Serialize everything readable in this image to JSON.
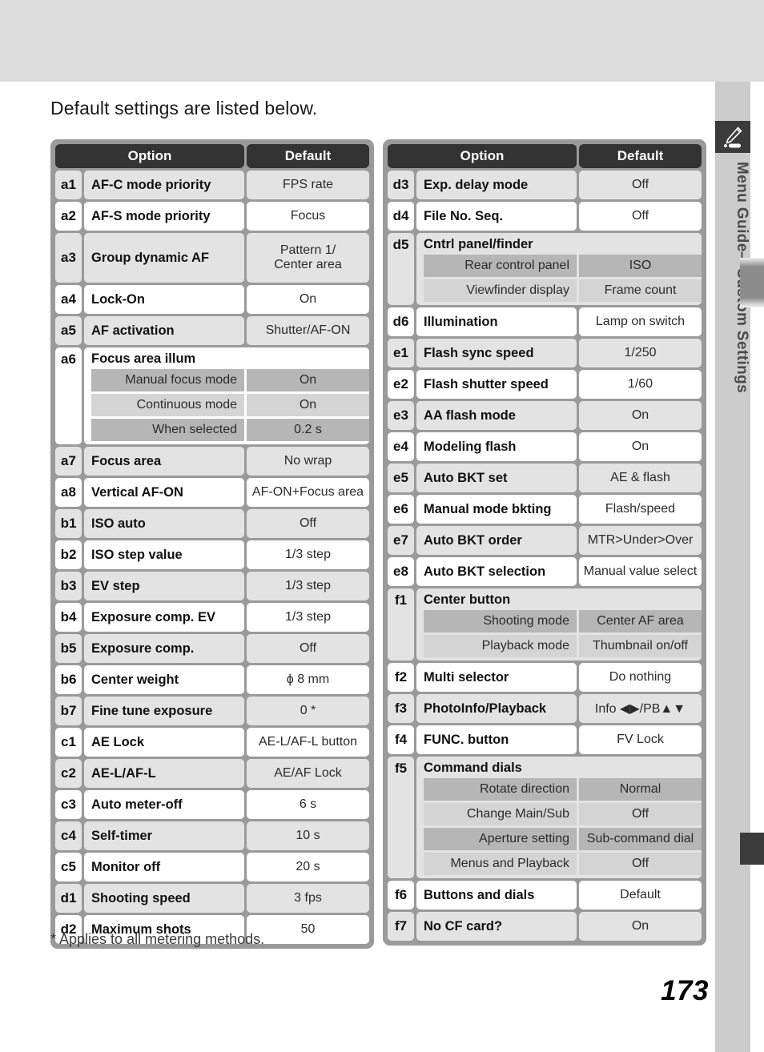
{
  "page": {
    "title": "Default settings are listed below.",
    "footnote": "* Applies to all metering methods.",
    "number": "173",
    "side_label": "Menu Guide—Custom Settings",
    "side_icon": "pencil-icon"
  },
  "table_headers": {
    "option": "Option",
    "default": "Default"
  },
  "left_table": [
    {
      "code": "a1",
      "option": "AF-C mode priority",
      "default": "FPS rate",
      "shade": "gray"
    },
    {
      "code": "a2",
      "option": "AF-S mode priority",
      "default": "Focus",
      "shade": "white"
    },
    {
      "code": "a3",
      "option": "Group dynamic AF",
      "default": "Pattern 1/\nCenter area",
      "shade": "gray",
      "tall": true
    },
    {
      "code": "a4",
      "option": "Lock-On",
      "default": "On",
      "shade": "white"
    },
    {
      "code": "a5",
      "option": "AF activation",
      "default": "Shutter/AF-ON",
      "shade": "gray"
    },
    {
      "code": "a6",
      "option": "Focus area illum",
      "shade": "white",
      "group": true,
      "subrows": [
        {
          "label": "Manual focus mode",
          "value": "On",
          "tone": "dark"
        },
        {
          "label": "Continuous mode",
          "value": "On",
          "tone": "light"
        },
        {
          "label": "When selected",
          "value": "0.2 s",
          "tone": "dark"
        }
      ]
    },
    {
      "code": "a7",
      "option": "Focus area",
      "default": "No wrap",
      "shade": "gray"
    },
    {
      "code": "a8",
      "option": "Vertical AF-ON",
      "default": "AF-ON+Focus area",
      "shade": "white"
    },
    {
      "code": "b1",
      "option": "ISO auto",
      "default": "Off",
      "shade": "gray"
    },
    {
      "code": "b2",
      "option": "ISO step value",
      "default": "1/3 step",
      "shade": "white"
    },
    {
      "code": "b3",
      "option": "EV step",
      "default": "1/3 step",
      "shade": "gray"
    },
    {
      "code": "b4",
      "option": "Exposure comp. EV",
      "default": "1/3 step",
      "shade": "white"
    },
    {
      "code": "b5",
      "option": "Exposure comp.",
      "default": "Off",
      "shade": "gray"
    },
    {
      "code": "b6",
      "option": "Center weight",
      "default": "ϕ 8 mm",
      "shade": "white"
    },
    {
      "code": "b7",
      "option": "Fine tune exposure",
      "default": "0 *",
      "shade": "gray"
    },
    {
      "code": "c1",
      "option": "AE Lock",
      "default": "AE-L/AF-L button",
      "shade": "white"
    },
    {
      "code": "c2",
      "option": "AE-L/AF-L",
      "default": "AE/AF Lock",
      "shade": "gray"
    },
    {
      "code": "c3",
      "option": "Auto meter-off",
      "default": "6 s",
      "shade": "white"
    },
    {
      "code": "c4",
      "option": "Self-timer",
      "default": "10 s",
      "shade": "gray"
    },
    {
      "code": "c5",
      "option": "Monitor off",
      "default": "20 s",
      "shade": "white"
    },
    {
      "code": "d1",
      "option": "Shooting speed",
      "default": "3 fps",
      "shade": "gray"
    },
    {
      "code": "d2",
      "option": "Maximum shots",
      "default": "50",
      "shade": "white"
    }
  ],
  "right_table": [
    {
      "code": "d3",
      "option": "Exp. delay mode",
      "default": "Off",
      "shade": "gray"
    },
    {
      "code": "d4",
      "option": "File No. Seq.",
      "default": "Off",
      "shade": "white"
    },
    {
      "code": "d5",
      "option": "Cntrl panel/finder",
      "shade": "gray",
      "group": true,
      "subrows": [
        {
          "label": "Rear control panel",
          "value": "ISO",
          "tone": "dark"
        },
        {
          "label": "Viewfinder display",
          "value": "Frame count",
          "tone": "light"
        }
      ]
    },
    {
      "code": "d6",
      "option": "Illumination",
      "default": "Lamp on switch",
      "shade": "white"
    },
    {
      "code": "e1",
      "option": "Flash sync speed",
      "default": "1/250",
      "shade": "gray"
    },
    {
      "code": "e2",
      "option": "Flash shutter speed",
      "default": "1/60",
      "shade": "white"
    },
    {
      "code": "e3",
      "option": "AA flash mode",
      "default": "On",
      "shade": "gray"
    },
    {
      "code": "e4",
      "option": "Modeling flash",
      "default": "On",
      "shade": "white"
    },
    {
      "code": "e5",
      "option": "Auto BKT set",
      "default": "AE & flash",
      "shade": "gray"
    },
    {
      "code": "e6",
      "option": "Manual mode bkting",
      "default": "Flash/speed",
      "shade": "white"
    },
    {
      "code": "e7",
      "option": "Auto BKT order",
      "default": "MTR>Under>Over",
      "shade": "gray"
    },
    {
      "code": "e8",
      "option": "Auto BKT selection",
      "default": "Manual value select",
      "shade": "white"
    },
    {
      "code": "f1",
      "option": "Center button",
      "shade": "gray",
      "group": true,
      "subrows": [
        {
          "label": "Shooting mode",
          "value": "Center AF area",
          "tone": "dark"
        },
        {
          "label": "Playback mode",
          "value": "Thumbnail on/off",
          "tone": "light"
        }
      ]
    },
    {
      "code": "f2",
      "option": "Multi selector",
      "default": "Do nothing",
      "shade": "white"
    },
    {
      "code": "f3",
      "option": "PhotoInfo/Playback",
      "default": "Info ◀▶/PB▲▼",
      "shade": "gray"
    },
    {
      "code": "f4",
      "option": "FUNC. button",
      "default": "FV Lock",
      "shade": "white"
    },
    {
      "code": "f5",
      "option": "Command dials",
      "shade": "gray",
      "group": true,
      "subrows": [
        {
          "label": "Rotate direction",
          "value": "Normal",
          "tone": "dark"
        },
        {
          "label": "Change Main/Sub",
          "value": "Off",
          "tone": "light"
        },
        {
          "label": "Aperture setting",
          "value": "Sub-command dial",
          "tone": "dark"
        },
        {
          "label": "Menus and Playback",
          "value": "Off",
          "tone": "light"
        }
      ]
    },
    {
      "code": "f6",
      "option": "Buttons and dials",
      "default": "Default",
      "shade": "white"
    },
    {
      "code": "f7",
      "option": "No CF card?",
      "default": "On",
      "shade": "gray"
    }
  ]
}
